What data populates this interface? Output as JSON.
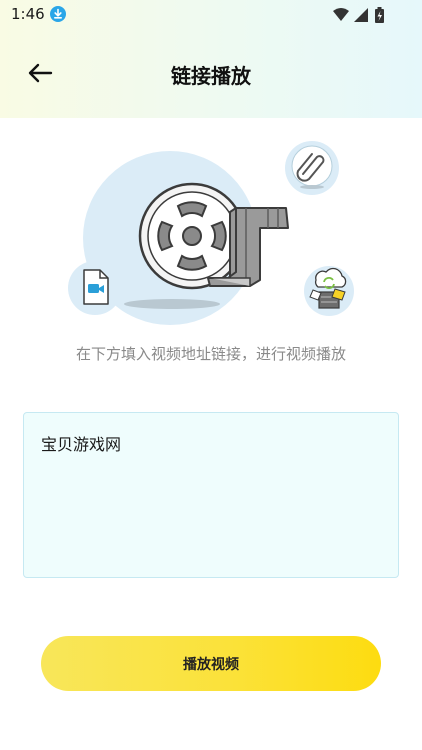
{
  "status_bar": {
    "time": "1:46",
    "icons": [
      "download-icon",
      "wifi-icon",
      "signal-icon",
      "battery-icon"
    ]
  },
  "header": {
    "back_icon": "arrow-left-icon",
    "title": "链接播放"
  },
  "illustration": {
    "icons": [
      "film-reel-icon",
      "paperclip-icon",
      "video-file-icon",
      "cloud-server-icon"
    ]
  },
  "main": {
    "hint": "在下方填入视频地址链接，进行视频播放",
    "url_input_value": "宝贝游戏网",
    "play_button_label": "播放视频"
  },
  "colors": {
    "accent_yellow": "#fddc10",
    "input_background": "#effdfd",
    "illustration_blue": "#dbecf7"
  }
}
